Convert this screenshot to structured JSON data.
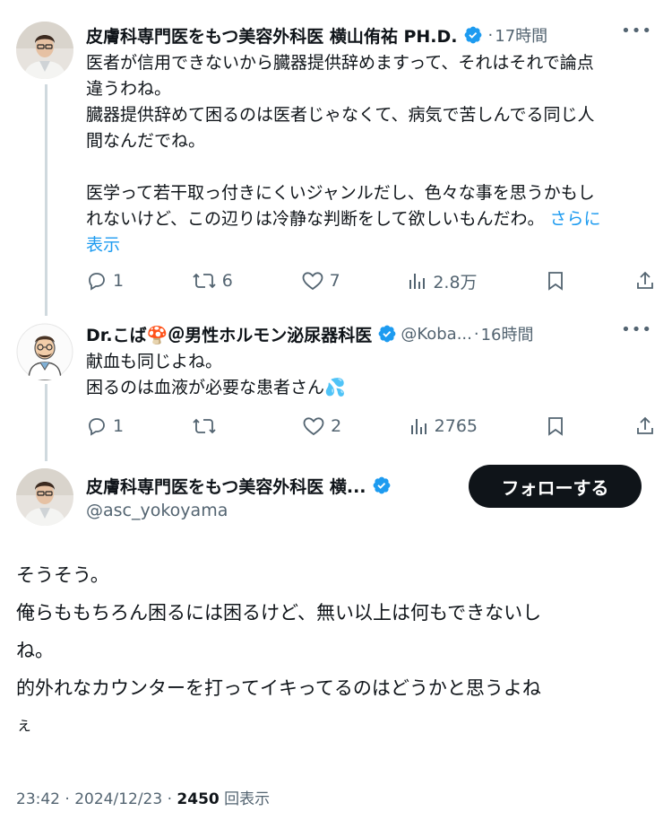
{
  "thread": [
    {
      "author": "皮膚科専門医をもつ美容外科医 横山侑祐 PH.D.",
      "time": "17時間",
      "lines": [
        "医者が信用できないから臓器提供辞めますって、それはそれで論点",
        "違うわね。",
        "臓器提供辞めて困るのは医者じゃなくて、病気で苦しんでる同じ人",
        "間なんだでね。",
        "",
        "医学って若干取っ付きにくいジャンルだし、色々な事を思うかもし",
        "れないけど、この辺りは冷静な判断をして欲しいもんだわ。"
      ],
      "show_more": "さらに",
      "show_more_2": "表示",
      "replies": "1",
      "reposts": "6",
      "likes": "7",
      "views": "2.8万"
    },
    {
      "author": "Dr.こば🍄＠男性ホルモン泌尿器科医",
      "handle": "@Koba...",
      "time": "16時間",
      "lines": [
        "献血も同じよね。",
        "困るのは血液が必要な患者さん💦"
      ],
      "replies": "1",
      "reposts": "",
      "likes": "2",
      "views": "2765"
    }
  ],
  "main": {
    "author": "皮膚科専門医をもつ美容外科医 横...",
    "handle": "@asc_yokoyama",
    "follow_label": "フォローする",
    "lines": [
      "そうそう。",
      "俺らももちろん困るには困るけど、無い以上は何もできないし",
      "ね。",
      "的外れなカウンターを打ってイキってるのはどうかと思うよね",
      "ぇ"
    ],
    "timestamp": "23:42 · 2024/12/23 · ",
    "views_count": "2450",
    "views_label": " 回表示"
  },
  "more_label": "•••",
  "dot": "·",
  "colors": {
    "accent": "#1d9bf0",
    "text": "#0f1419",
    "secondary": "#536471",
    "button_bg": "#0f1419"
  },
  "icons": [
    "verified-badge-icon",
    "reply-icon",
    "repost-icon",
    "like-icon",
    "views-icon",
    "bookmark-icon",
    "share-icon"
  ]
}
